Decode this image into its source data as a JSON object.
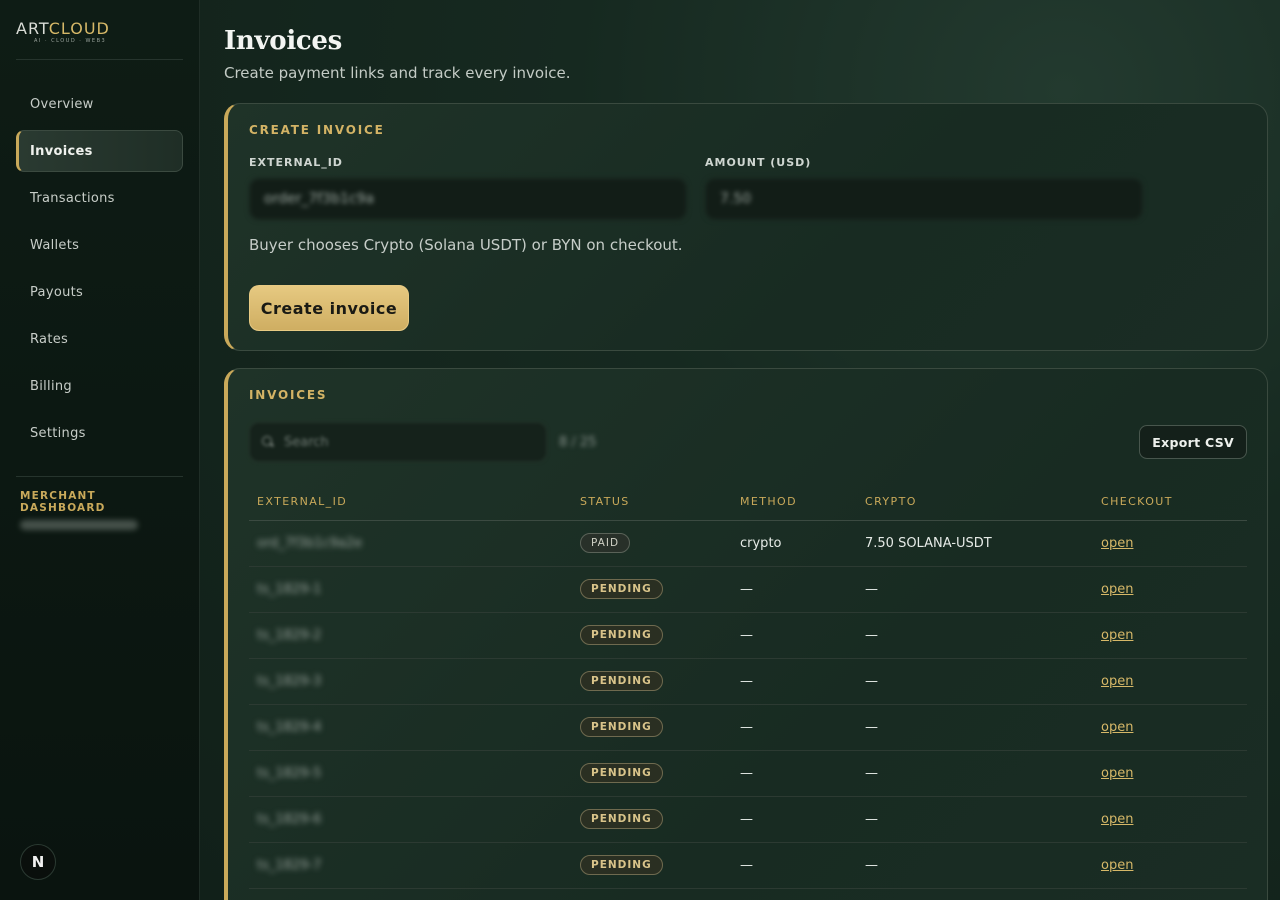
{
  "brand": {
    "logo_art": "ART",
    "logo_cloud": "CLOUD",
    "logo_sub": "AI · CLOUD · WEB3"
  },
  "sidebar": {
    "items": [
      {
        "label": "Overview",
        "active": false
      },
      {
        "label": "Invoices",
        "active": true
      },
      {
        "label": "Transactions",
        "active": false
      },
      {
        "label": "Wallets",
        "active": false
      },
      {
        "label": "Payouts",
        "active": false
      },
      {
        "label": "Rates",
        "active": false
      },
      {
        "label": "Billing",
        "active": false
      },
      {
        "label": "Settings",
        "active": false
      }
    ],
    "merchant_label": "MERCHANT DASHBOARD",
    "footer_badge": "N"
  },
  "page": {
    "title": "Invoices",
    "subtitle": "Create payment links and track every invoice."
  },
  "create": {
    "title": "CREATE INVOICE",
    "external_id_label": "EXTERNAL_ID",
    "external_id_value": "order_7f3b1c9a",
    "amount_label": "AMOUNT (USD)",
    "amount_value": "7.50",
    "hint": "Buyer chooses Crypto (Solana USDT) or BYN on checkout.",
    "button": "Create invoice"
  },
  "list": {
    "title": "INVOICES",
    "search_placeholder": "Search",
    "count": "8 / 25",
    "export_button": "Export CSV",
    "columns": [
      "EXTERNAL_ID",
      "STATUS",
      "METHOD",
      "CRYPTO",
      "CHECKOUT"
    ],
    "rows": [
      {
        "external_id": "ord_7f3b1c9a2e",
        "status": "PAID",
        "method": "crypto",
        "crypto": "7.50 SOLANA-USDT",
        "checkout": "open"
      },
      {
        "external_id": "ts_1829-1",
        "status": "PENDING",
        "method": "—",
        "crypto": "—",
        "checkout": "open"
      },
      {
        "external_id": "ts_1829-2",
        "status": "PENDING",
        "method": "—",
        "crypto": "—",
        "checkout": "open"
      },
      {
        "external_id": "ts_1829-3",
        "status": "PENDING",
        "method": "—",
        "crypto": "—",
        "checkout": "open"
      },
      {
        "external_id": "ts_1829-4",
        "status": "PENDING",
        "method": "—",
        "crypto": "—",
        "checkout": "open"
      },
      {
        "external_id": "ts_1829-5",
        "status": "PENDING",
        "method": "—",
        "crypto": "—",
        "checkout": "open"
      },
      {
        "external_id": "ts_1829-6",
        "status": "PENDING",
        "method": "—",
        "crypto": "—",
        "checkout": "open"
      },
      {
        "external_id": "ts_1829-7",
        "status": "PENDING",
        "method": "—",
        "crypto": "—",
        "checkout": "open"
      }
    ]
  },
  "colors": {
    "accent": "#c9a95a",
    "background": "#112019",
    "sidebar": "#0e1c15"
  }
}
